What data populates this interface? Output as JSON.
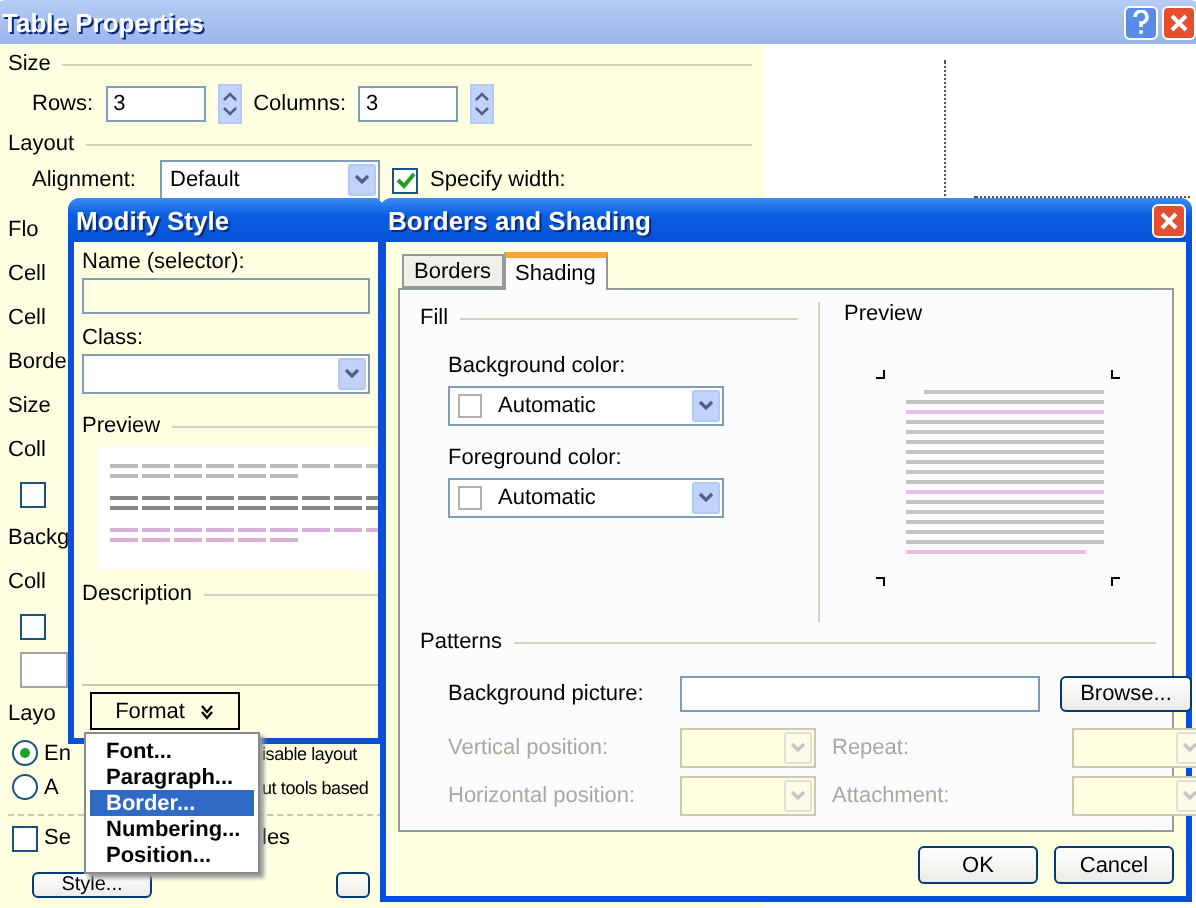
{
  "table_properties": {
    "title": "Table Properties",
    "size_heading": "Size",
    "rows_label": "Rows:",
    "rows_value": "3",
    "columns_label": "Columns:",
    "columns_value": "3",
    "layout_heading": "Layout",
    "alignment_label": "Alignment:",
    "alignment_value": "Default",
    "specify_width": {
      "label": "Specify width:",
      "checked": true
    },
    "left_items": [
      {
        "kind": "label",
        "text": "Flo"
      },
      {
        "kind": "label",
        "text": "Cell"
      },
      {
        "kind": "label",
        "text": "Cell"
      },
      {
        "kind": "label",
        "text": "Borde"
      },
      {
        "kind": "label",
        "text": "Size"
      },
      {
        "kind": "label",
        "text": "Coll"
      },
      {
        "kind": "checkbox",
        "checked": false
      },
      {
        "kind": "label",
        "text": "Backg"
      },
      {
        "kind": "label",
        "text": "Coll"
      },
      {
        "kind": "checkbox",
        "checked": false
      },
      {
        "kind": "swatch"
      },
      {
        "kind": "label",
        "text": "Layo"
      }
    ],
    "layout_options": [
      {
        "label": "En",
        "selected": true,
        "tail": "isable layout"
      },
      {
        "label": "A",
        "selected": false,
        "tail": "ut tools based"
      }
    ],
    "last_option": {
      "label": "Se",
      "checked": false,
      "tail": "les"
    },
    "style_button": "Style..."
  },
  "modify_style": {
    "title": "Modify Style",
    "name_label": "Name (selector):",
    "class_label": "Class:",
    "preview_heading": "Preview",
    "description_heading": "Description",
    "format_button": "Format"
  },
  "format_menu": [
    {
      "label": "Font...",
      "selected": false
    },
    {
      "label": "Paragraph...",
      "selected": false
    },
    {
      "label": "Border...",
      "selected": true
    },
    {
      "label": "Numbering...",
      "selected": false
    },
    {
      "label": "Position...",
      "selected": false
    }
  ],
  "borders_and_shading": {
    "title": "Borders and Shading",
    "tabs": [
      {
        "label": "Borders",
        "selected": false
      },
      {
        "label": "Shading",
        "selected": true
      }
    ],
    "fill_heading": "Fill",
    "background_color_label": "Background color:",
    "background_color_value": "Automatic",
    "foreground_color_label": "Foreground color:",
    "foreground_color_value": "Automatic",
    "preview_heading": "Preview",
    "patterns_heading": "Patterns",
    "background_picture_label": "Background picture:",
    "browse_button": "Browse...",
    "pattern_fields": [
      {
        "label": "Vertical position:",
        "disabled": true
      },
      {
        "label": "Repeat:",
        "disabled": true
      },
      {
        "label": "Horizontal position:",
        "disabled": true
      },
      {
        "label": "Attachment:",
        "disabled": true
      }
    ],
    "buttons": [
      "OK",
      "Cancel"
    ]
  }
}
